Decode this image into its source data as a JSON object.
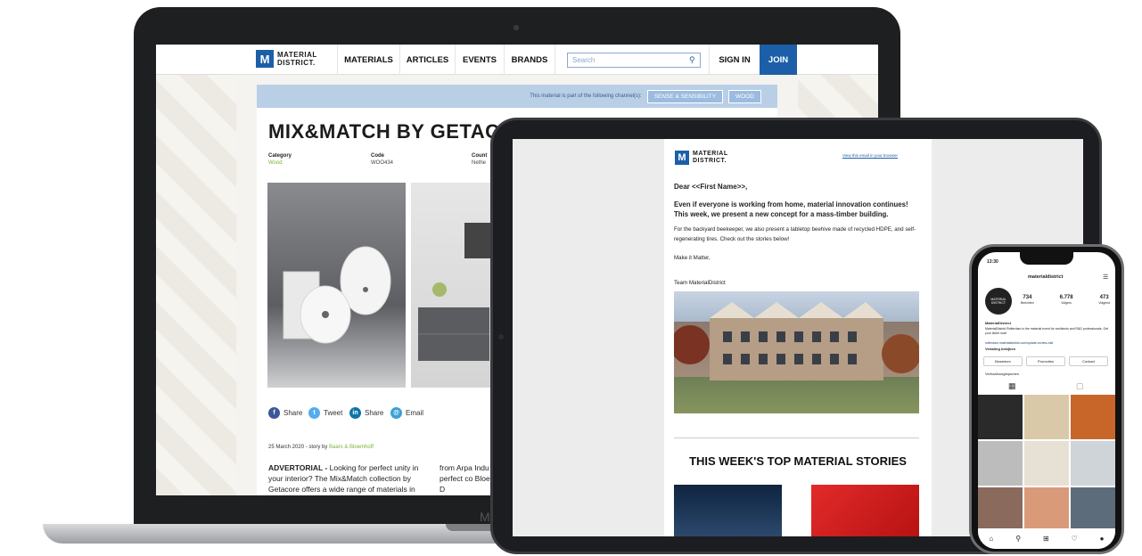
{
  "laptop": {
    "base_label": "M",
    "logo": {
      "line1": "MATERIAL",
      "line2": "DISTRICT."
    },
    "nav": [
      "MATERIALS",
      "ARTICLES",
      "EVENTS",
      "BRANDS"
    ],
    "search_placeholder": "Search",
    "sign_in": "SIGN IN",
    "join": "JOIN",
    "channel_text": "This material is part of the following channel(s):",
    "channels": [
      "SENSE & SENSIBILITY",
      "WOOD"
    ],
    "title": "MIX&MATCH BY GETAC",
    "meta": [
      {
        "h": "Category",
        "v": "Wood"
      },
      {
        "h": "Code",
        "v": "WOO434"
      },
      {
        "h": "Count",
        "v": "Nethe"
      }
    ],
    "share": [
      {
        "label": "Share",
        "color": "#3b5998",
        "icon": "f"
      },
      {
        "label": "Tweet",
        "color": "#55acee",
        "icon": "t"
      },
      {
        "label": "Share",
        "color": "#0e76a8",
        "icon": "in"
      },
      {
        "label": "Email",
        "color": "#3aa0d8",
        "icon": "@"
      }
    ],
    "date": "25 March 2020 - story by",
    "author": "Baars & Bloemhoff",
    "article_left_bold": "ADVERTORIAL -",
    "article_left": " Looking for perfect unity in your interior? The Mix&Match collection by Getacore offers a wide range of materials in",
    "article_right": "from Arpa Indu only perfect co Bloemhoff's D"
  },
  "tablet": {
    "logo": {
      "line1": "MATERIAL",
      "line2": "DISTRICT."
    },
    "browser_link": "View this email in your browser",
    "greeting": "Dear <<First Name>>,",
    "lead": "Even if everyone is working from home, material innovation continues! This week, we present a new concept for a mass-timber building.",
    "body": "For the backyard beekeeper, we also present a tabletop beehive made of recycled HDPE, and self-regenerating tires. Check out the stories below!",
    "signoff": "Make it Matter,",
    "team": "Team MaterialDistrict",
    "heading": "THIS WEEK'S TOP MATERIAL STORIES"
  },
  "phone": {
    "time": "13:30",
    "username": "materialdistrict",
    "stats": [
      {
        "n": "734",
        "l": "Berichten"
      },
      {
        "n": "6.778",
        "l": "Volgers"
      },
      {
        "n": "473",
        "l": "Volgend"
      }
    ],
    "bio_name": "MaterialDistrict",
    "bio": "MaterialDistrict Rotterdam is the material event for architects and R&D professionals. Get your ticket now!",
    "bio_link": "rotterdam.materialdistrict.com/update-review-visit",
    "translation": "Vertaling bekijken",
    "buttons": [
      "Bewerken",
      "Promoties",
      "Contact"
    ],
    "highlights": "Verhaalhoogtepunten"
  }
}
